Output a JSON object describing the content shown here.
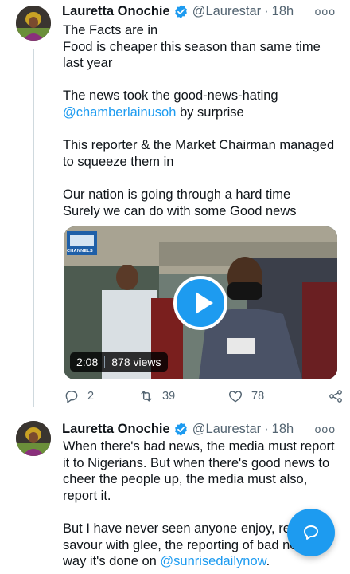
{
  "tweets": [
    {
      "author_name": "Lauretta Onochie",
      "handle": "@Laurestar",
      "separator": "·",
      "time": "18h",
      "more": "ooo",
      "text_lines": [
        "The Facts are in",
        "Food is cheaper this season than same time last year",
        "",
        "The news took the good-news-hating",
        "@chamberlainusoh|| by surprise",
        "",
        "This reporter & the Market Chairman managed to squeeze them in",
        "",
        "Our nation is going through a hard time",
        "Surely we can do with some Good news"
      ],
      "line1": "The Facts are in",
      "line2": "Food is cheaper this season than same time last year",
      "line3": "The news took the good-news-hating",
      "mention": "@chamberlainusoh",
      "line4_rest": " by surprise",
      "line5": "This reporter & the Market Chairman managed to squeeze them in",
      "line6": "Our nation is going through a hard time",
      "line7": "Surely we can do with some Good news",
      "video": {
        "duration": "2:08",
        "views": "878 views",
        "channel_logo_text": "CHANNELS"
      },
      "replies": "2",
      "retweets": "39",
      "likes": "78"
    },
    {
      "author_name": "Lauretta Onochie",
      "handle": "@Laurestar",
      "separator": "·",
      "time": "18h",
      "more": "ooo",
      "para1": "When there's bad news, the media must report it to Nigerians. But when there's good news to cheer the people up, the media must also, report it.",
      "para2_line1": "But I have never seen anyone enjoy, relish",
      "para2_line2": "savour with glee, the reporting of bad new",
      "para2_line3_pre": "way it's done on ",
      "mention": "@sunrisedailynow",
      "para2_line3_post": "."
    }
  ],
  "colors": {
    "accent": "#1d9bf0",
    "text": "#0f1419",
    "secondary": "#536471"
  },
  "icons": {
    "verified": "verified-badge-icon",
    "reply": "reply-icon",
    "retweet": "retweet-icon",
    "like": "heart-icon",
    "share": "share-icon",
    "compose": "compose-icon",
    "play": "play-icon",
    "more": "more-icon"
  }
}
